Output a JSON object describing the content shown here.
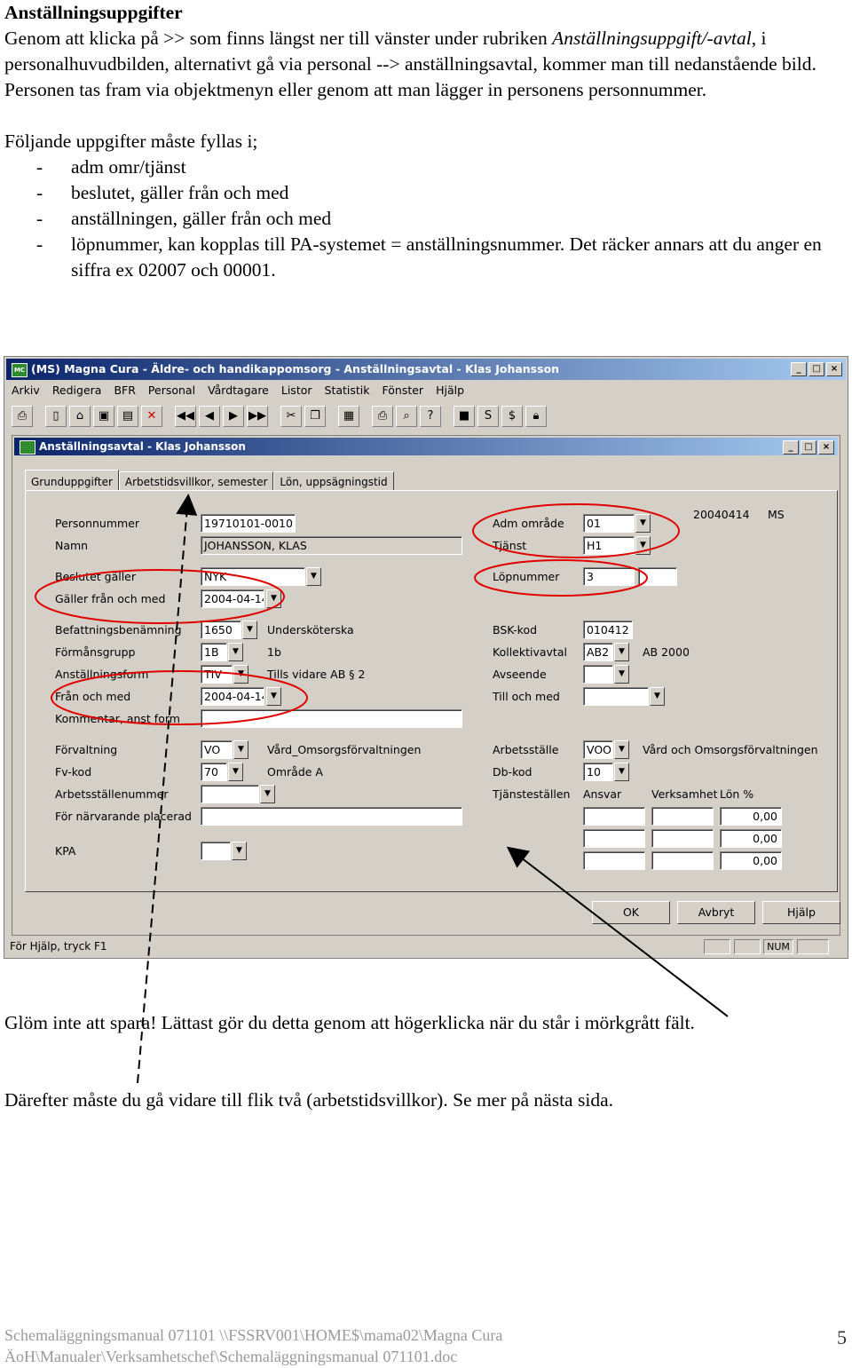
{
  "doc": {
    "heading": "Anställningsuppgifter",
    "intro_1": "Genom att klicka på >> som finns längst ner till vänster under rubriken ",
    "intro_italic": "Anställningsuppgift/-avtal,",
    "intro_2": " i personalhuvudbilden, alternativt gå via personal --> anställningsavtal, kommer man till nedanstående bild. Personen tas fram via objektmenyn eller genom att man lägger in personens personnummer.",
    "list_intro": "Följande uppgifter måste fyllas i;",
    "list": [
      "adm omr/tjänst",
      "beslutet, gäller från och med",
      "anställningen, gäller från och med",
      "löpnummer, kan kopplas till PA-systemet = anställningsnummer. Det räcker annars att du anger en siffra ex 02007 och 00001."
    ],
    "dash": "-",
    "save_note": "Glöm inte att spara! Lättast gör du detta genom att högerklicka när du står i mörkgrått fält.",
    "next_note": "Därefter måste du gå vidare till flik två (arbetstidsvillkor). Se mer på nästa sida.",
    "footer_line1": "Schemaläggningsmanual 071101 \\\\FSSRV001\\HOME$\\mama02\\Magna Cura",
    "footer_line2": "ÄoH\\Manualer\\Verksamhetschef\\Schemaläggningsmanual 071101.doc",
    "page_number": "5"
  },
  "app": {
    "title": "(MS) Magna Cura - Äldre- och handikappomsorg - Anställningsavtal - Klas Johansson",
    "app_icon": "MC",
    "menu": [
      "Arkiv",
      "Redigera",
      "BFR",
      "Personal",
      "Vårdtagare",
      "Listor",
      "Statistik",
      "Fönster",
      "Hjälp"
    ],
    "child_title": "Anställningsavtal - Klas Johansson",
    "tabs": [
      "Grunduppgifter",
      "Arbetstidsvillkor, semester",
      "Lön, uppsägningstid"
    ],
    "toolbar_icons": [
      "print-icon",
      "new-icon",
      "open-icon",
      "save-icon",
      "save-all-icon",
      "delete-icon",
      "first-icon",
      "prev-icon",
      "next-icon",
      "last-icon",
      "cut-icon",
      "copy-icon",
      "paste-icon",
      "print-preview-icon",
      "preview-icon",
      "help-icon",
      "stop-icon",
      "s-icon",
      "dollar-icon",
      "lock-icon"
    ],
    "status_text": "För Hjälp, tryck F1",
    "status_num": "NUM",
    "form": {
      "personnummer_label": "Personnummer",
      "personnummer": "19710101-0010",
      "namn_label": "Namn",
      "namn": "JOHANSSON, KLAS",
      "beslutet_label": "Beslutet gäller",
      "beslutet": "NYK",
      "galler_label": "Gäller från och med",
      "galler": "2004-04-14",
      "befattning_label": "Befattningsbenämning",
      "befattning_code": "1650",
      "befattning_text": "Undersköterska",
      "formansgrupp_label": "Förmånsgrupp",
      "formansgrupp_code": "1B",
      "formansgrupp_text": "1b",
      "anstform_label": "Anställningsform",
      "anstform_code": "TIV",
      "anstform_text": "Tills vidare AB § 2",
      "fran_label": "Från och med",
      "fran": "2004-04-14",
      "kommentar_label": "Kommentar, anst form",
      "forvaltning_label": "Förvaltning",
      "forvaltning_code": "VO",
      "forvaltning_text": "Vård_Omsorgsförvaltningen",
      "fvkod_label": "Fv-kod",
      "fvkod_code": "70",
      "fvkod_text": "Område A",
      "arbetsstallenummer_label": "Arbetsställenummer",
      "placerad_label": "För närvarande placerad",
      "kpa_label": "KPA",
      "date_label": "20040414",
      "user_label": "MS",
      "adm_label": "Adm område",
      "adm": "01",
      "tjanst_label": "Tjänst",
      "tjanst": "H1",
      "lopnummer_label": "Löpnummer",
      "lopnummer": "3",
      "bsk_label": "BSK-kod",
      "bsk": "010412",
      "kollektiv_label": "Kollektivavtal",
      "kollektiv_code": "AB2",
      "kollektiv_text": "AB 2000",
      "avseende_label": "Avseende",
      "tillochmed_label": "Till och med",
      "arbetsstalle_label": "Arbetsställe",
      "arbetsstalle_code": "VOO",
      "arbetsstalle_text": "Vård och Omsorgsförvaltningen",
      "dbkod_label": "Db-kod",
      "dbkod": "10",
      "tjanstestallen_label": "Tjänsteställen",
      "ansvar_label": "Ansvar",
      "verksamhet_label": "Verksamhet",
      "lon_label": "Lön %",
      "lon_values": [
        "0,00",
        "0,00",
        "0,00"
      ]
    },
    "buttons": {
      "ok": "OK",
      "avbryt": "Avbryt",
      "hjalp": "Hjälp"
    }
  },
  "colors": {
    "titlebar_start": "#0a246a",
    "titlebar_end": "#a6caf0",
    "window_bg": "#d4d0c8",
    "annotation_red": "#e00000"
  }
}
